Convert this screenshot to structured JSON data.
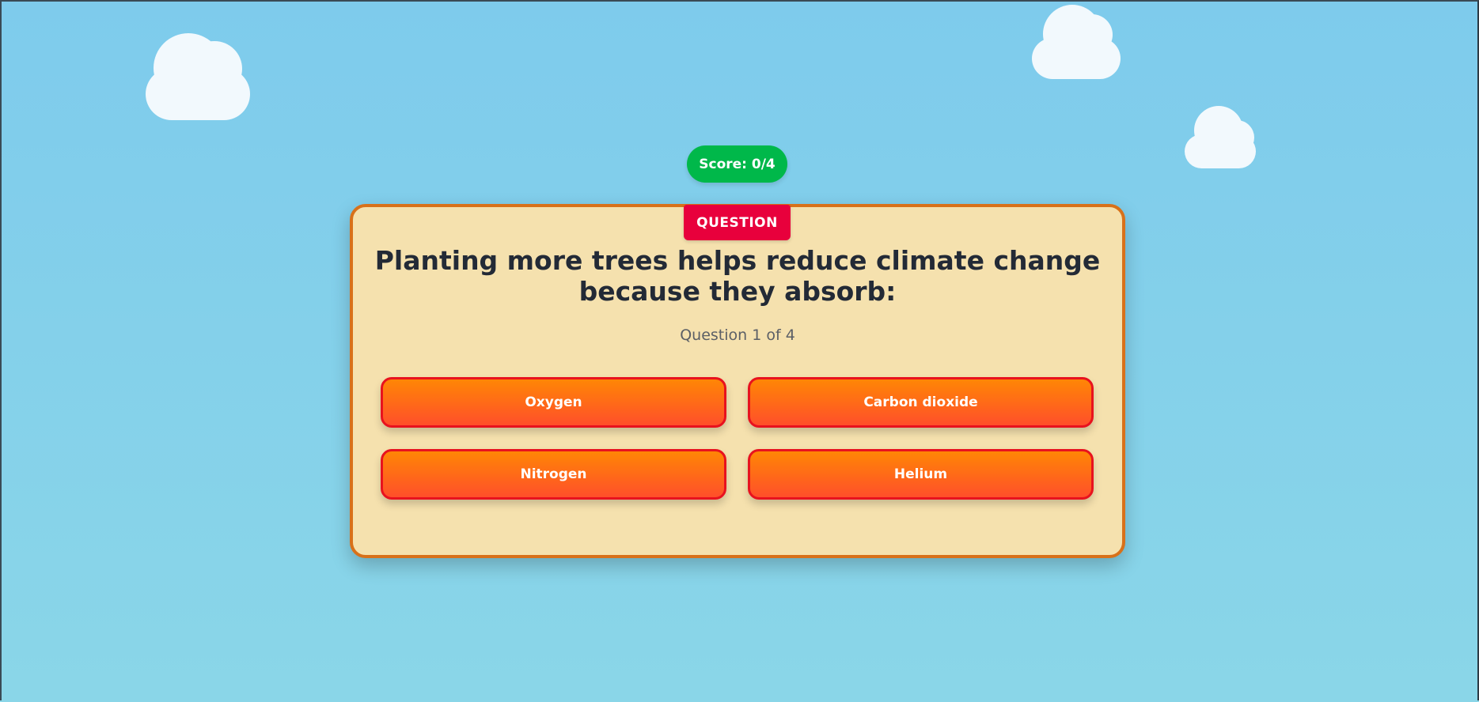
{
  "colors": {
    "sky": "#7ecbec",
    "score_badge": "#00b84a",
    "card_bg": "#f5e1ae",
    "card_border": "#d8711a",
    "tag_bg": "#e8003c",
    "answer_gradient_top": "#ff8605",
    "answer_gradient_bottom": "#ff4f2a",
    "answer_border": "#e8121e",
    "cloud": "#f2f9fd"
  },
  "score": {
    "label": "Score: 0/4"
  },
  "card": {
    "tag": "QUESTION",
    "question": "Planting more trees helps reduce climate change because they absorb:",
    "progress": "Question 1 of 4"
  },
  "answers": [
    {
      "label": "Oxygen"
    },
    {
      "label": "Carbon dioxide"
    },
    {
      "label": "Nitrogen"
    },
    {
      "label": "Helium"
    }
  ]
}
